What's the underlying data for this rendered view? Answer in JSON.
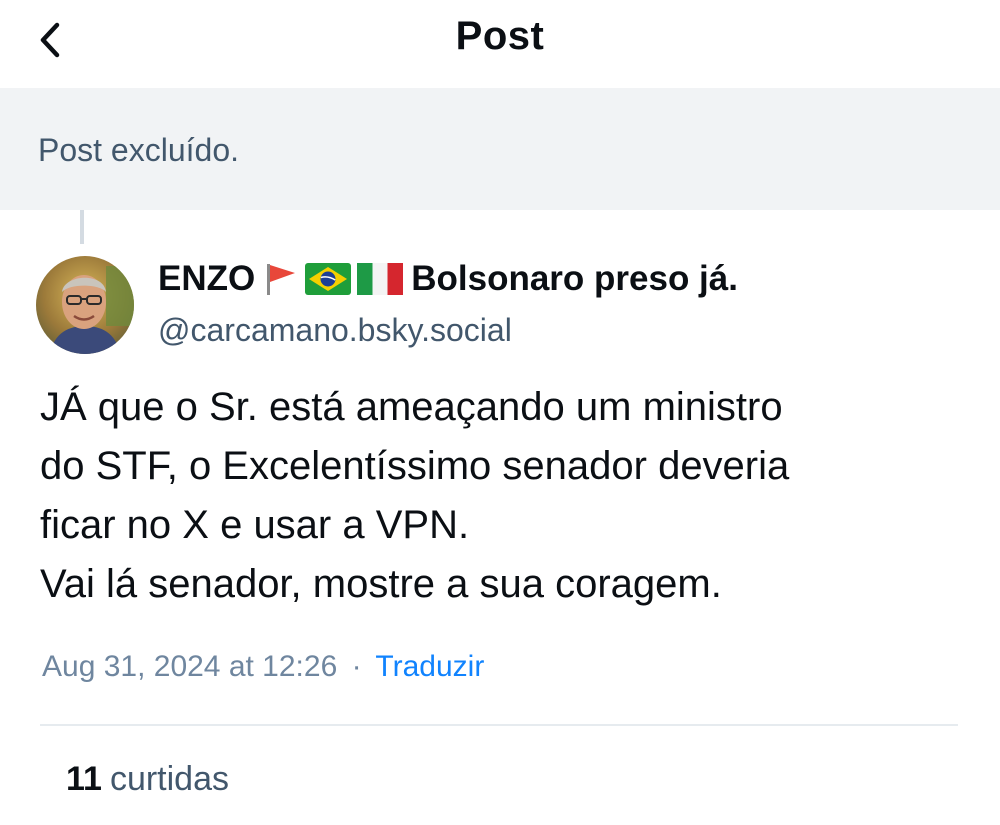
{
  "header": {
    "title": "Post",
    "back_icon": "chevron-left-icon"
  },
  "parent_post": {
    "status_text": "Post excluído."
  },
  "post": {
    "author": {
      "display_name": "ENZO",
      "display_name_suffix": "Bolsonaro preso já.",
      "flags": [
        "red-flag-icon",
        "brazil-flag-icon",
        "italy-flag-icon"
      ],
      "handle": "@carcamano.bsky.social"
    },
    "body_lines": [
      "JÁ que o Sr. está ameaçando um ministro",
      "do STF, o Excelentíssimo senador deveria",
      "ficar no X e usar a VPN.",
      "Vai lá senador, mostre a sua coragem."
    ],
    "timestamp": "Aug 31, 2024 at 12:26",
    "separator": "·",
    "translate_label": "Traduzir",
    "likes": {
      "count": "11",
      "label": "curtidas"
    }
  },
  "colors": {
    "text_primary": "#0b0f14",
    "text_secondary": "#42576c",
    "link": "#1083fe",
    "banner_bg": "#f1f3f5"
  }
}
